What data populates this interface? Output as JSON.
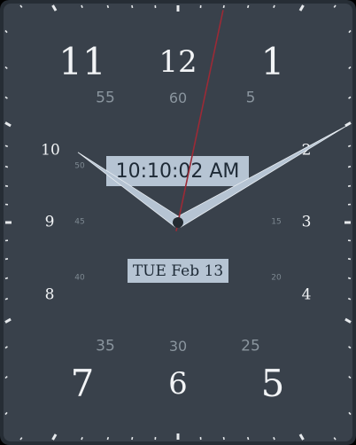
{
  "clock": {
    "digital_time": "10:10:02 AM",
    "date": "TUE Feb 13",
    "time": {
      "hours": 10,
      "minutes": 10,
      "seconds": 2
    },
    "hour_numerals": {
      "h12": "12",
      "h1": "1",
      "h2": "2",
      "h3": "3",
      "h4": "4",
      "h5": "5",
      "h6": "6",
      "h7": "7",
      "h8": "8",
      "h9": "9",
      "h10": "10",
      "h11": "11"
    },
    "minute_numerals": {
      "m5": "5",
      "m25": "25",
      "m30": "30",
      "m35": "35",
      "m55": "55",
      "m60": "60"
    },
    "second_numerals": {
      "s15": "15",
      "s20": "20",
      "s40": "40",
      "s45": "45",
      "s50": "50"
    },
    "colors": {
      "face": "#39414b",
      "bezel": "#262d35",
      "ticks": "#e6e9ec",
      "hands": "#b6c4d3",
      "second_hand": "#9c2a36",
      "digital_box": "#b6c4d3"
    }
  }
}
